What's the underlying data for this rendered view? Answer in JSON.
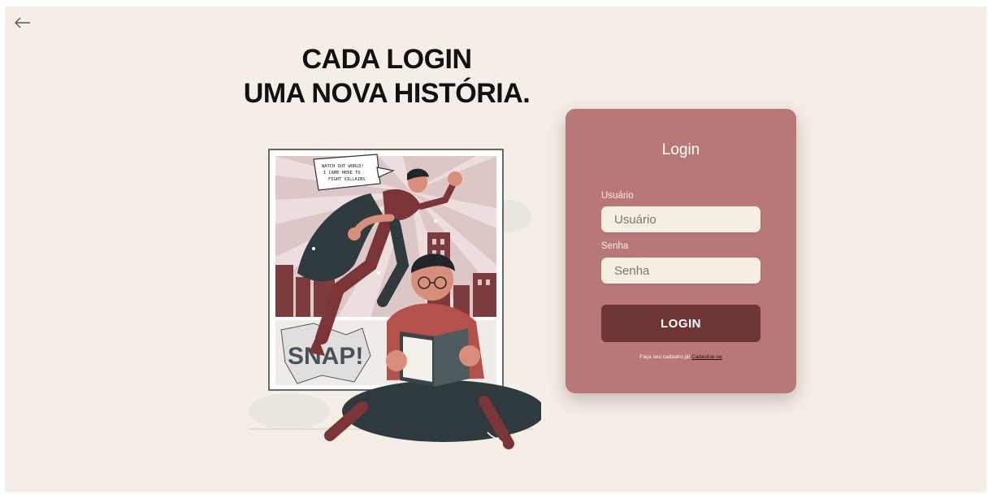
{
  "icons": {
    "back": "arrow-left-icon"
  },
  "hero": {
    "line1": "CADA LOGIN",
    "line2": "UMA NOVA HISTÓRIA.",
    "speech_bubble": [
      "WATCH OUT WORLD!",
      "I CAME HERE TO",
      "FIGHT VILLAINS"
    ],
    "sound_effect": "SNAP!"
  },
  "login": {
    "title": "Login",
    "username_label": "Usuário",
    "username_placeholder": "Usuário",
    "password_label": "Senha",
    "password_placeholder": "Senha",
    "submit_label": "LOGIN",
    "signup_prompt": "Faça seu cadastro já!",
    "signup_link": "Cadastrar-se"
  },
  "colors": {
    "background": "#f4eee7",
    "card": "#b97878",
    "button": "#6e3537",
    "field": "#f5eee2"
  }
}
